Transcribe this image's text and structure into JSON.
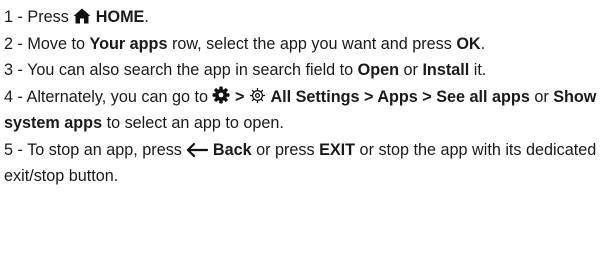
{
  "steps": [
    {
      "num": "1",
      "sep": " - ",
      "pre": "Press ",
      "icon": "home-icon",
      "bold": "HOME",
      "post": "."
    },
    {
      "num": "2",
      "sep": " - ",
      "pre": "Move to ",
      "bold1": "Your apps",
      "mid": " row, select the app you want and press ",
      "bold2": "OK",
      "post": "."
    },
    {
      "num": "3",
      "sep": " - ",
      "pre": "You can also search the app in search field to ",
      "bold1": "Open",
      "mid": " or ",
      "bold2": "Install",
      "post": " it."
    },
    {
      "num": "4",
      "sep": " - ",
      "pre": "Alternately, you can go to ",
      "icon1": "settings-gear-icon",
      "gt1": " > ",
      "icon2": "all-settings-icon",
      "bold1": "All Settings > Apps > See all apps",
      "mid": " or ",
      "bold2": "Show system apps",
      "post": " to select an app to open."
    },
    {
      "num": "5",
      "sep": " - ",
      "pre": "To stop an app, press ",
      "icon": "back-arrow-icon",
      "bold1": "Back",
      "mid": " or press ",
      "bold2": "EXIT",
      "post": " or stop the app with its dedicated exit/stop button."
    }
  ],
  "colors": {
    "text": "#1a1a1a",
    "background": "#ffffff"
  }
}
